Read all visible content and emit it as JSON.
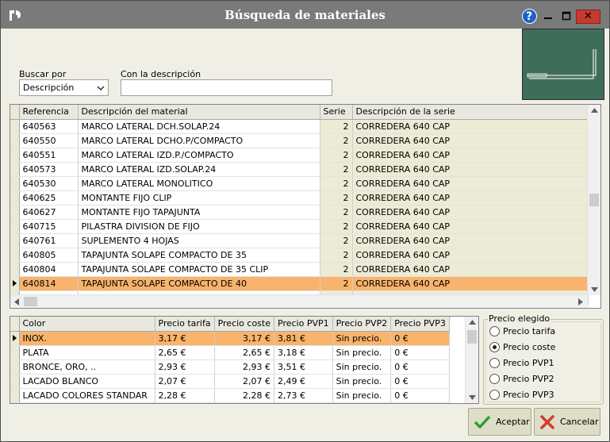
{
  "window": {
    "title": "Búsqueda de materiales",
    "close_glyph": "✕",
    "help_glyph": "?",
    "accent_color": "#f8b36c"
  },
  "search": {
    "by_label": "Buscar por",
    "by_value": "Descripción",
    "desc_label": "Con la descripción",
    "desc_value": ""
  },
  "materials": {
    "columns": [
      "Referencia",
      "Descripción del material",
      "Serie",
      "Descripción de la serie"
    ],
    "rows": [
      {
        "ref": "640563",
        "desc": "MARCO LATERAL DCH.SOLAP.24",
        "serie": "2",
        "serie_desc": "CORREDERA 640 CAP"
      },
      {
        "ref": "640550",
        "desc": "MARCO LATERAL DCHO.P/COMPACTO",
        "serie": "2",
        "serie_desc": "CORREDERA 640 CAP"
      },
      {
        "ref": "640551",
        "desc": "MARCO LATERAL IZD.P./COMPACTO",
        "serie": "2",
        "serie_desc": "CORREDERA 640 CAP"
      },
      {
        "ref": "640573",
        "desc": "MARCO LATERAL IZD.SOLAP.24",
        "serie": "2",
        "serie_desc": "CORREDERA 640 CAP"
      },
      {
        "ref": "640530",
        "desc": "MARCO LATERAL MONOLITICO",
        "serie": "2",
        "serie_desc": "CORREDERA 640 CAP"
      },
      {
        "ref": "640625",
        "desc": "MONTANTE FIJO CLIP",
        "serie": "2",
        "serie_desc": "CORREDERA 640 CAP"
      },
      {
        "ref": "640627",
        "desc": "MONTANTE FIJO TAPAJUNTA",
        "serie": "2",
        "serie_desc": "CORREDERA 640 CAP"
      },
      {
        "ref": "640715",
        "desc": "PILASTRA DIVISION DE FIJO",
        "serie": "2",
        "serie_desc": "CORREDERA 640 CAP"
      },
      {
        "ref": "640761",
        "desc": "SUPLEMENTO 4 HOJAS",
        "serie": "2",
        "serie_desc": "CORREDERA 640 CAP"
      },
      {
        "ref": "640805",
        "desc": "TAPAJUNTA SOLAPE COMPACTO DE 35",
        "serie": "2",
        "serie_desc": "CORREDERA 640 CAP"
      },
      {
        "ref": "640804",
        "desc": "TAPAJUNTA SOLAPE COMPACTO DE 35 CLIP",
        "serie": "2",
        "serie_desc": "CORREDERA 640 CAP"
      },
      {
        "ref": "640814",
        "desc": "TAPAJUNTA SOLAPE COMPACTO DE 40",
        "serie": "2",
        "serie_desc": "CORREDERA 640 CAP"
      }
    ],
    "selected_index": 11
  },
  "colors": {
    "columns": [
      "Color",
      "Precio tarifa",
      "Precio coste",
      "Precio PVP1",
      "Precio PVP2",
      "Precio PVP3"
    ],
    "rows": [
      {
        "color": "INOX.",
        "tarifa": "3,17 €",
        "coste": "3,17 €",
        "pvp1": "3,81 €",
        "pvp2": "Sin precio.",
        "pvp3": "0 €"
      },
      {
        "color": "PLATA",
        "tarifa": "2,65 €",
        "coste": "2,65 €",
        "pvp1": "3,18 €",
        "pvp2": "Sin precio.",
        "pvp3": "0 €"
      },
      {
        "color": "BRONCE, ORO, ..",
        "tarifa": "2,93 €",
        "coste": "2,93 €",
        "pvp1": "3,51 €",
        "pvp2": "Sin precio.",
        "pvp3": "0 €"
      },
      {
        "color": "LACADO BLANCO",
        "tarifa": "2,07 €",
        "coste": "2,07 €",
        "pvp1": "2,49 €",
        "pvp2": "Sin precio.",
        "pvp3": "0 €"
      },
      {
        "color": "LACADO COLORES STANDAR",
        "tarifa": "2,28 €",
        "coste": "2,28 €",
        "pvp1": "2,73 €",
        "pvp2": "Sin precio.",
        "pvp3": "0 €"
      }
    ],
    "selected_index": 0
  },
  "price": {
    "legend": "Precio elegido",
    "options": [
      "Precio tarifa",
      "Precio coste",
      "Precio PVP1",
      "Precio PVP2",
      "Precio PVP3"
    ],
    "selected_index": 1
  },
  "buttons": {
    "accept": "Aceptar",
    "cancel": "Cancelar"
  }
}
